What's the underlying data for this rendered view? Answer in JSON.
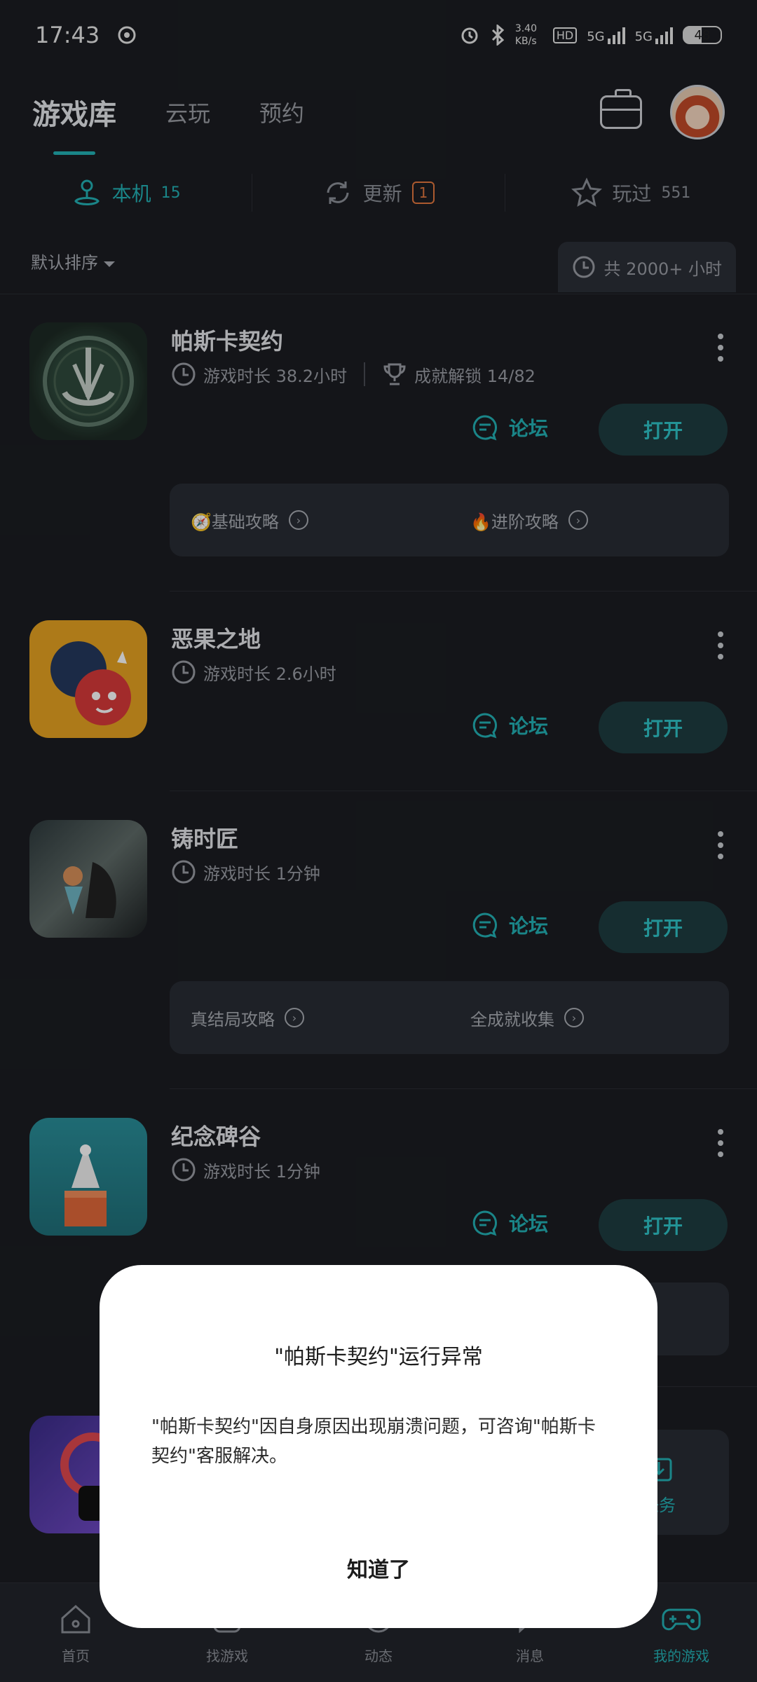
{
  "status_bar": {
    "time": "17:43",
    "speed": "3.40 KB/s",
    "network": "5G",
    "network2": "5G",
    "battery": "48"
  },
  "header": {
    "tabs": [
      "游戏库",
      "云玩",
      "预约"
    ]
  },
  "subtabs": {
    "local": {
      "label": "本机",
      "count": "15"
    },
    "update": {
      "label": "更新",
      "count": "1"
    },
    "played": {
      "label": "玩过",
      "count": "551"
    }
  },
  "sort": {
    "label": "默认排序",
    "total": "共 2000+ 小时"
  },
  "games": [
    {
      "title": "帕斯卡契约",
      "playtime": "游戏时长 38.2小时",
      "achievement": "成就解锁 14/82",
      "forum": "论坛",
      "open": "打开",
      "guides": [
        "🧭基础攻略",
        "🔥进阶攻略"
      ]
    },
    {
      "title": "恶果之地",
      "playtime": "游戏时长 2.6小时",
      "forum": "论坛",
      "open": "打开"
    },
    {
      "title": "铸时匠",
      "playtime": "游戏时长 1分钟",
      "forum": "论坛",
      "open": "打开",
      "guides": [
        "真结局攻略",
        "全成就收集"
      ]
    },
    {
      "title": "纪念碑谷",
      "playtime": "游戏时长 1分钟",
      "forum": "论坛",
      "open": "打开"
    }
  ],
  "partial": {
    "task_label": "任务"
  },
  "bottom_nav": [
    "首页",
    "找游戏",
    "动态",
    "消息",
    "我的游戏"
  ],
  "dialog": {
    "title": "\"帕斯卡契约\"运行异常",
    "body": "\"帕斯卡契约\"因自身原因出现崩溃问题，可咨询\"帕斯卡契约\"客服解决。",
    "button": "知道了"
  },
  "colors": {
    "accent": "#23b2b6",
    "badge": "#e6783f",
    "background": "#1b1d22"
  }
}
